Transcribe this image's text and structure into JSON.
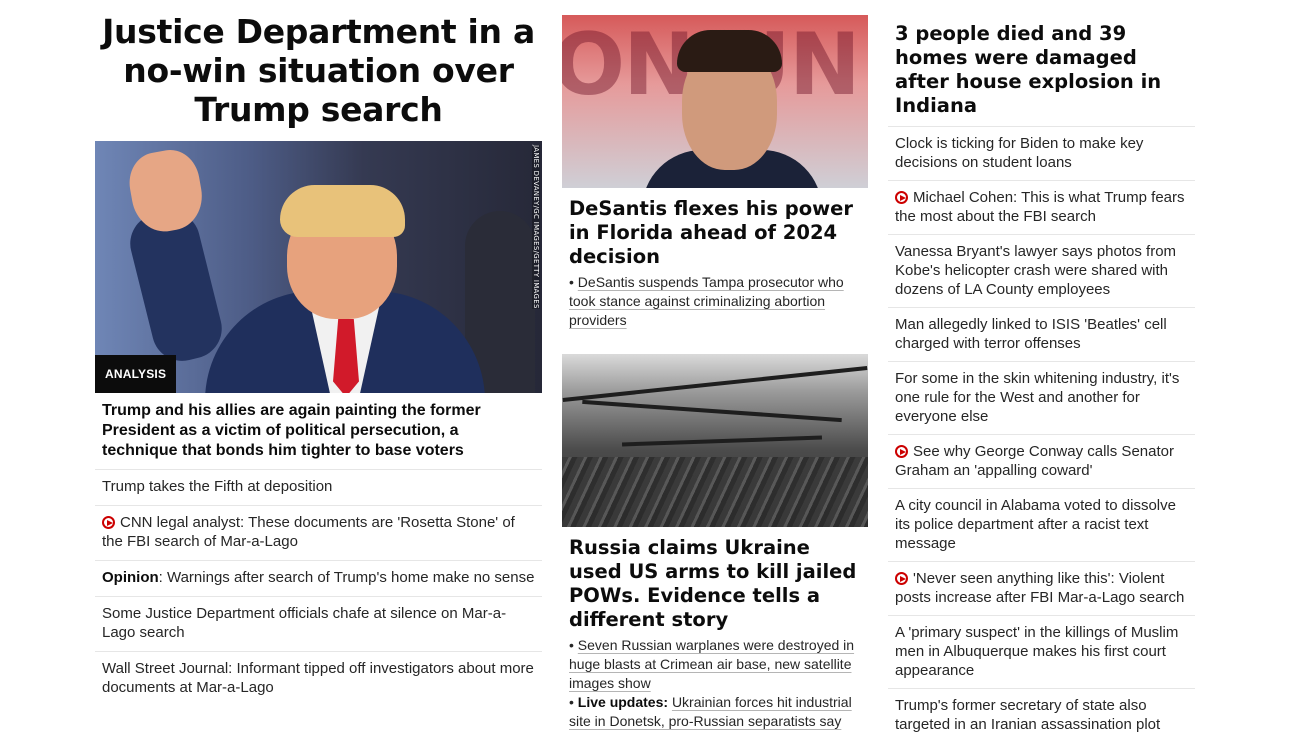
{
  "col1": {
    "headline": "Justice Department in a no-win situation over Trump search",
    "photo_credit": "JAMES DEVANEY/GC IMAGES/GETTY IMAGES",
    "tag": "ANALYSIS",
    "lead": "Trump and his allies are again painting the former President as a victim of political persecution, a technique that bonds him tighter to base voters",
    "items": [
      {
        "text": "Trump takes the Fifth at deposition"
      },
      {
        "text": "CNN legal analyst: These documents are 'Rosetta Stone' of the FBI search of Mar-a-Lago"
      },
      {
        "prefix": "Opinion",
        "text": ": Warnings after search of Trump's home make no sense"
      },
      {
        "text": "Some Justice Department officials chafe at silence on Mar-a-Lago search"
      },
      {
        "text": "Wall Street Journal: Informant tipped off investigators about more documents at Mar-a-Lago"
      }
    ]
  },
  "col2": {
    "story1": {
      "headline": "DeSantis flexes his power in Florida ahead of 2024 decision",
      "bullet": "DeSantis suspends Tampa prosecutor who took stance against criminalizing abortion providers"
    },
    "story2": {
      "headline": "Russia claims Ukraine used US arms to kill jailed POWs. Evidence tells a different story",
      "bullet1": "Seven Russian warplanes were destroyed in huge blasts at Crimean air base, new satellite images show",
      "bullet2_prefix": "Live updates:",
      "bullet2": "Ukrainian forces hit industrial site in Donetsk, pro-Russian separatists say"
    }
  },
  "col3": {
    "headline": "3 people died and 39 homes were damaged after house explosion in Indiana",
    "items": [
      {
        "text": "Clock is ticking for Biden to make key decisions on student loans"
      },
      {
        "text": "Michael Cohen: This is what Trump fears the most about the FBI search"
      },
      {
        "text": "Vanessa Bryant's lawyer says photos from Kobe's helicopter crash were shared with dozens of LA County employees"
      },
      {
        "text": "Man allegedly linked to ISIS 'Beatles' cell charged with terror offenses"
      },
      {
        "text": "For some in the skin whitening industry, it's one rule for the West and another for everyone else"
      },
      {
        "text": "See why George Conway calls Senator Graham an 'appalling coward'"
      },
      {
        "text": "A city council in Alabama voted to dissolve its police department after a racist text message"
      },
      {
        "text": "'Never seen anything like this': Violent posts increase after FBI Mar-a-Lago search"
      },
      {
        "text": "A 'primary suspect' in the killings of Muslim men in Albuquerque makes his first court appearance"
      },
      {
        "text": "Trump's former secretary of state also targeted in an Iranian assassination plot"
      }
    ]
  },
  "icons": {
    "video": "play-circle-icon"
  },
  "colors": {
    "accent": "#cc0000",
    "text": "#0c0c0c",
    "divider": "#e6e6e6"
  }
}
